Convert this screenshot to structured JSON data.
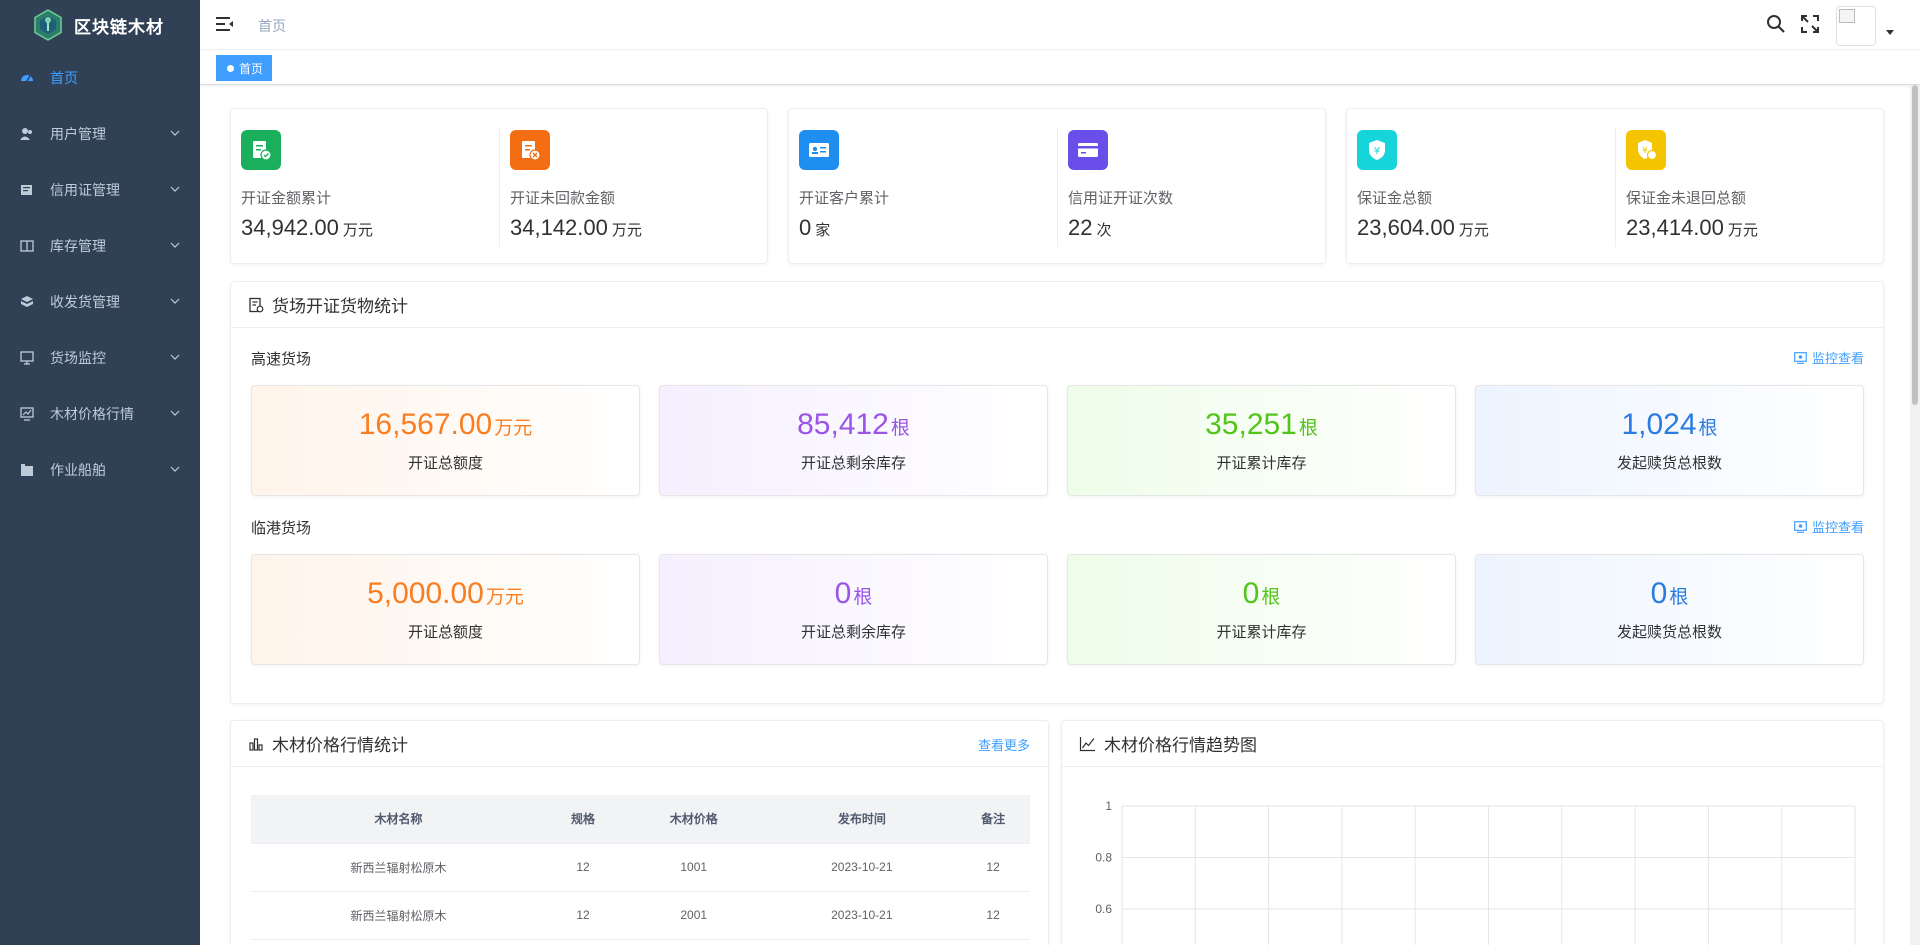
{
  "app": {
    "title": "区块链木材"
  },
  "sidebar": {
    "items": [
      {
        "label": "首页",
        "icon": "dashboard-icon",
        "active": true
      },
      {
        "label": "用户管理",
        "icon": "users-icon"
      },
      {
        "label": "信用证管理",
        "icon": "credit-letter-icon"
      },
      {
        "label": "库存管理",
        "icon": "inventory-icon"
      },
      {
        "label": "收发货管理",
        "icon": "shipping-icon"
      },
      {
        "label": "货场监控",
        "icon": "monitor-icon"
      },
      {
        "label": "木材价格行情",
        "icon": "price-icon"
      },
      {
        "label": "作业船舶",
        "icon": "ship-icon"
      }
    ]
  },
  "navbar": {
    "breadcrumb": "首页"
  },
  "tags": {
    "active": "首页"
  },
  "stats": [
    {
      "label": "开证金额累计",
      "value": "34,942.00",
      "unit": "万元",
      "color": "#1aaf5d",
      "icon": "invoice-icon"
    },
    {
      "label": "开证未回款金额",
      "value": "34,142.00",
      "unit": "万元",
      "color": "#f36e12",
      "icon": "invoice-pending-icon"
    },
    {
      "label": "开证客户累计",
      "value": "0",
      "unit": "家",
      "color": "#1e8ef0",
      "icon": "id-card-icon"
    },
    {
      "label": "信用证开证次数",
      "value": "22",
      "unit": "次",
      "color": "#6a4ee9",
      "icon": "card-icon"
    },
    {
      "label": "保证金总额",
      "value": "23,604.00",
      "unit": "万元",
      "color": "#15d5db",
      "icon": "shield-yuan-icon"
    },
    {
      "label": "保证金未退回总额",
      "value": "23,414.00",
      "unit": "万元",
      "color": "#f5c400",
      "icon": "shield-return-icon"
    }
  ],
  "yard_card": {
    "title": "货场开证货物统计",
    "monitor_label": "监控查看",
    "yards": [
      {
        "name": "高速货场",
        "metrics": [
          {
            "value": "16,567.00",
            "unit": "万元",
            "label": "开证总额度"
          },
          {
            "value": "85,412",
            "unit": "根",
            "label": "开证总剩余库存"
          },
          {
            "value": "35,251",
            "unit": "根",
            "label": "开证累计库存"
          },
          {
            "value": "1,024",
            "unit": "根",
            "label": "发起赎货总根数"
          }
        ]
      },
      {
        "name": "临港货场",
        "metrics": [
          {
            "value": "5,000.00",
            "unit": "万元",
            "label": "开证总额度"
          },
          {
            "value": "0",
            "unit": "根",
            "label": "开证总剩余库存"
          },
          {
            "value": "0",
            "unit": "根",
            "label": "开证累计库存"
          },
          {
            "value": "0",
            "unit": "根",
            "label": "发起赎货总根数"
          }
        ]
      }
    ]
  },
  "price_table": {
    "title": "木材价格行情统计",
    "more_label": "查看更多",
    "columns": [
      "木材名称",
      "规格",
      "木材价格",
      "发布时间",
      "备注"
    ],
    "rows": [
      [
        "新西兰辐射松原木",
        "12",
        "1001",
        "2023-10-21",
        "12"
      ],
      [
        "新西兰辐射松原木",
        "12",
        "2001",
        "2023-10-21",
        "12"
      ]
    ]
  },
  "chart_card": {
    "title": "木材价格行情趋势图"
  },
  "chart_data": {
    "type": "line",
    "title": "",
    "series": [],
    "ylim": [
      0,
      1
    ],
    "y_ticks": [
      "1",
      "0.8",
      "0.6"
    ],
    "grid": true
  }
}
